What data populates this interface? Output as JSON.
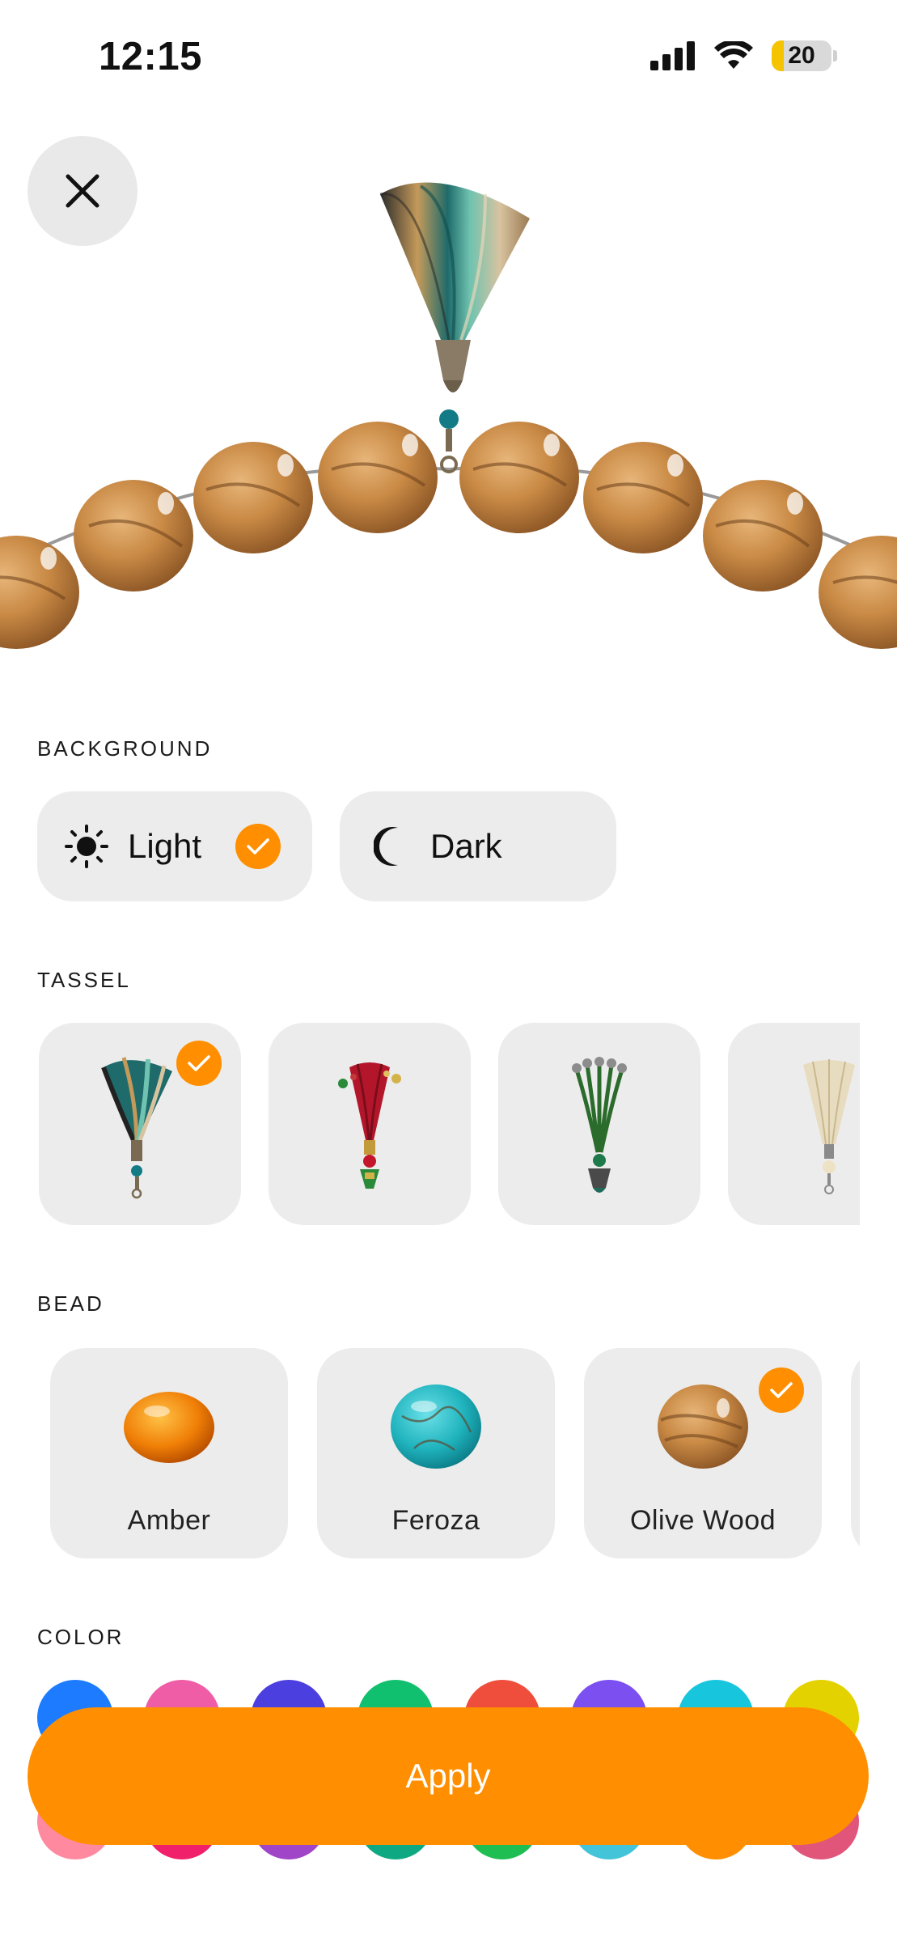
{
  "status_bar": {
    "time": "12:15",
    "battery": "20",
    "icons": [
      "signal-icon",
      "wifi-icon",
      "battery-icon"
    ]
  },
  "close_icon": "close-icon",
  "background": {
    "label": "BACKGROUND",
    "options": [
      {
        "label": "Light",
        "icon": "sun-icon",
        "selected": true
      },
      {
        "label": "Dark",
        "icon": "moon-icon",
        "selected": false
      }
    ]
  },
  "tassel": {
    "label": "TASSEL",
    "options": [
      {
        "name": "tassel-teal",
        "selected": true
      },
      {
        "name": "tassel-red",
        "selected": false
      },
      {
        "name": "tassel-green",
        "selected": false
      },
      {
        "name": "tassel-cream",
        "selected": false
      }
    ]
  },
  "bead": {
    "label": "BEAD",
    "options": [
      {
        "label": "Amber",
        "selected": false
      },
      {
        "label": "Feroza",
        "selected": false
      },
      {
        "label": "Olive Wood",
        "selected": true
      }
    ]
  },
  "color": {
    "label": "COLOR",
    "row1": [
      "#1c7bff",
      "#f05da7",
      "#4c3fe0",
      "#11c06f",
      "#ef4e3c",
      "#7b4ff0",
      "#17c6dd",
      "#e4d200"
    ],
    "row2": [
      "#ff8aa0",
      "#f0206a",
      "#a044c8",
      "#0ea882",
      "#1fbe53",
      "#44c4d8",
      "#ff8f00",
      "#e05579"
    ]
  },
  "accent": "#ff8f00",
  "apply_label": "Apply"
}
